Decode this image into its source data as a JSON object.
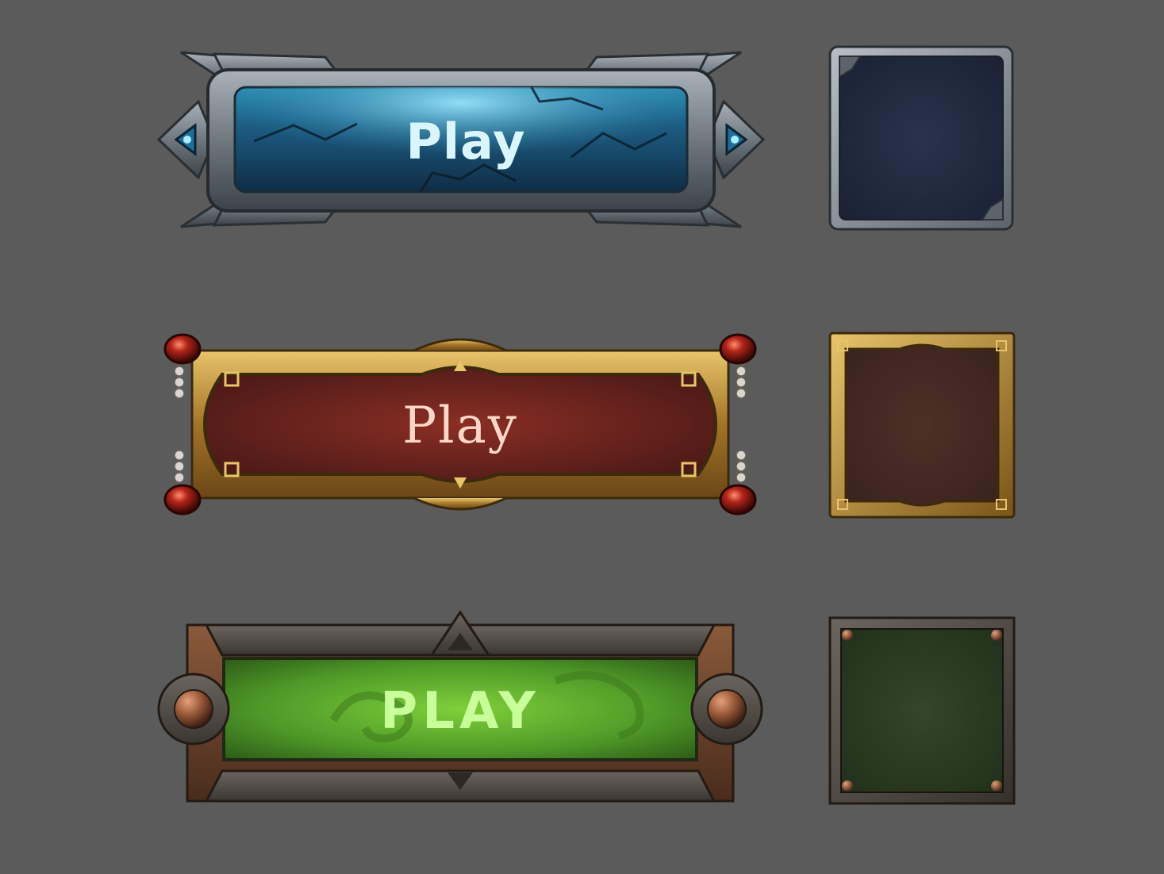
{
  "buttons": [
    {
      "label": "Play",
      "style": "ice-stone",
      "accent": "#3ab8e0"
    },
    {
      "label": "Play",
      "style": "gold-crimson",
      "accent": "#c8963a"
    },
    {
      "label": "PLAY",
      "style": "bronze-toxic",
      "accent": "#7fcf3a"
    }
  ],
  "panels": [
    {
      "style": "ice-stone",
      "accent": "#2a3a55"
    },
    {
      "style": "gold-crimson",
      "accent": "#4a2c24"
    },
    {
      "style": "bronze-toxic",
      "accent": "#2c3a22"
    }
  ],
  "colors": {
    "background": "#5b5b5b",
    "ice_glow": "#d9f6ff",
    "gold_text": "#ffd6c8",
    "green_text": "#c8ff9a"
  }
}
